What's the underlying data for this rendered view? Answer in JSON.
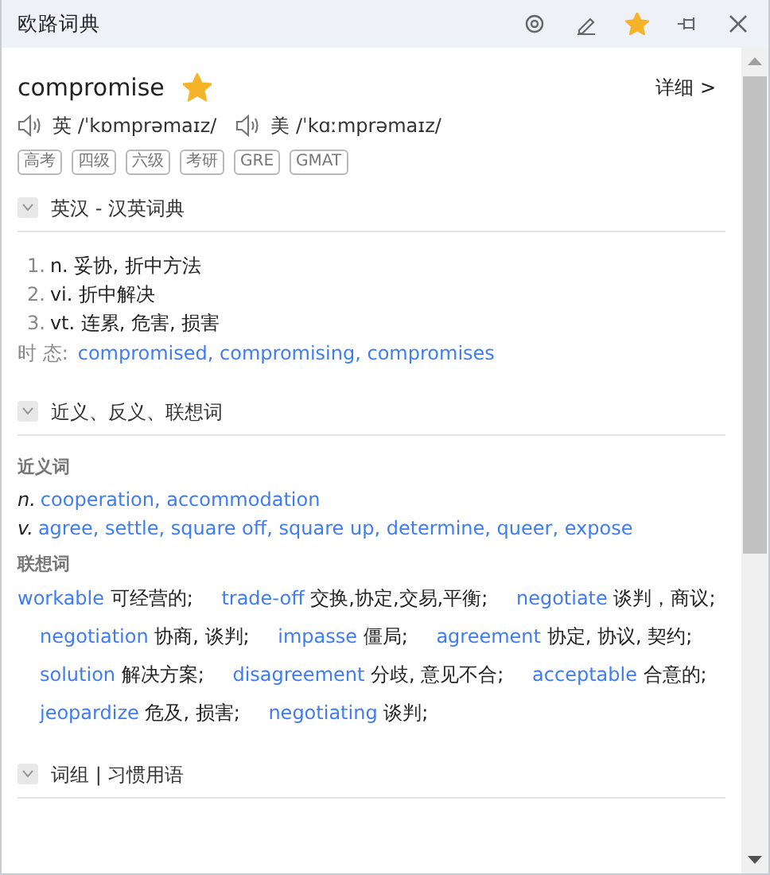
{
  "window": {
    "title": "欧路词典"
  },
  "title_buttons": [
    {
      "kind": "target",
      "active": false
    },
    {
      "kind": "edit",
      "active": false
    },
    {
      "kind": "star",
      "active": true
    },
    {
      "kind": "pin",
      "active": false
    },
    {
      "kind": "close",
      "active": false
    }
  ],
  "entry": {
    "word": "compromise",
    "favorited": true,
    "detail_link": "详细 >",
    "pronunciations": [
      {
        "region": "英",
        "ipa": "/ˈkɒmprəmaɪz/"
      },
      {
        "region": "美",
        "ipa": "/ˈkɑːmprəmaɪz/"
      }
    ],
    "tags": [
      "高考",
      "四级",
      "六级",
      "考研",
      "GRE",
      "GMAT"
    ]
  },
  "sections": [
    {
      "kind": "definitions",
      "title": "英汉 - 汉英词典",
      "expanded": true,
      "definitions": [
        {
          "number": "1.",
          "text": "n. 妥协, 折中方法"
        },
        {
          "number": "2.",
          "text": "vi. 折中解决"
        },
        {
          "number": "3.",
          "text": "vt. 连累, 危害, 损害"
        }
      ],
      "tense_label": "时 态:",
      "tense_forms": "compromised, compromising, compromises"
    },
    {
      "kind": "related",
      "title": "近义、反义、联想词",
      "expanded": true,
      "synonyms_label": "近义词",
      "synonyms": [
        {
          "pos": "n.",
          "words": "cooperation, accommodation"
        },
        {
          "pos": "v.",
          "words": "agree, settle, square off, square up, determine, queer, expose"
        }
      ],
      "associations_label": "联想词",
      "associations": [
        {
          "word": "workable",
          "meaning": "可经营的;"
        },
        {
          "word": "trade-off",
          "meaning": "交换,协定,交易,平衡;"
        },
        {
          "word": "negotiate",
          "meaning": "谈判，商议;"
        },
        {
          "word": "negotiation",
          "meaning": "协商, 谈判;"
        },
        {
          "word": "impasse",
          "meaning": "僵局;"
        },
        {
          "word": "agreement",
          "meaning": "协定, 协议, 契约;"
        },
        {
          "word": "solution",
          "meaning": "解决方案;"
        },
        {
          "word": "disagreement",
          "meaning": "分歧, 意见不合;"
        },
        {
          "word": "acceptable",
          "meaning": "合意的;"
        },
        {
          "word": "jeopardize",
          "meaning": "危及, 损害;"
        },
        {
          "word": "negotiating",
          "meaning": "谈判;"
        }
      ]
    },
    {
      "kind": "phrases",
      "title": "词组 | 习惯用语",
      "expanded": true
    }
  ]
}
